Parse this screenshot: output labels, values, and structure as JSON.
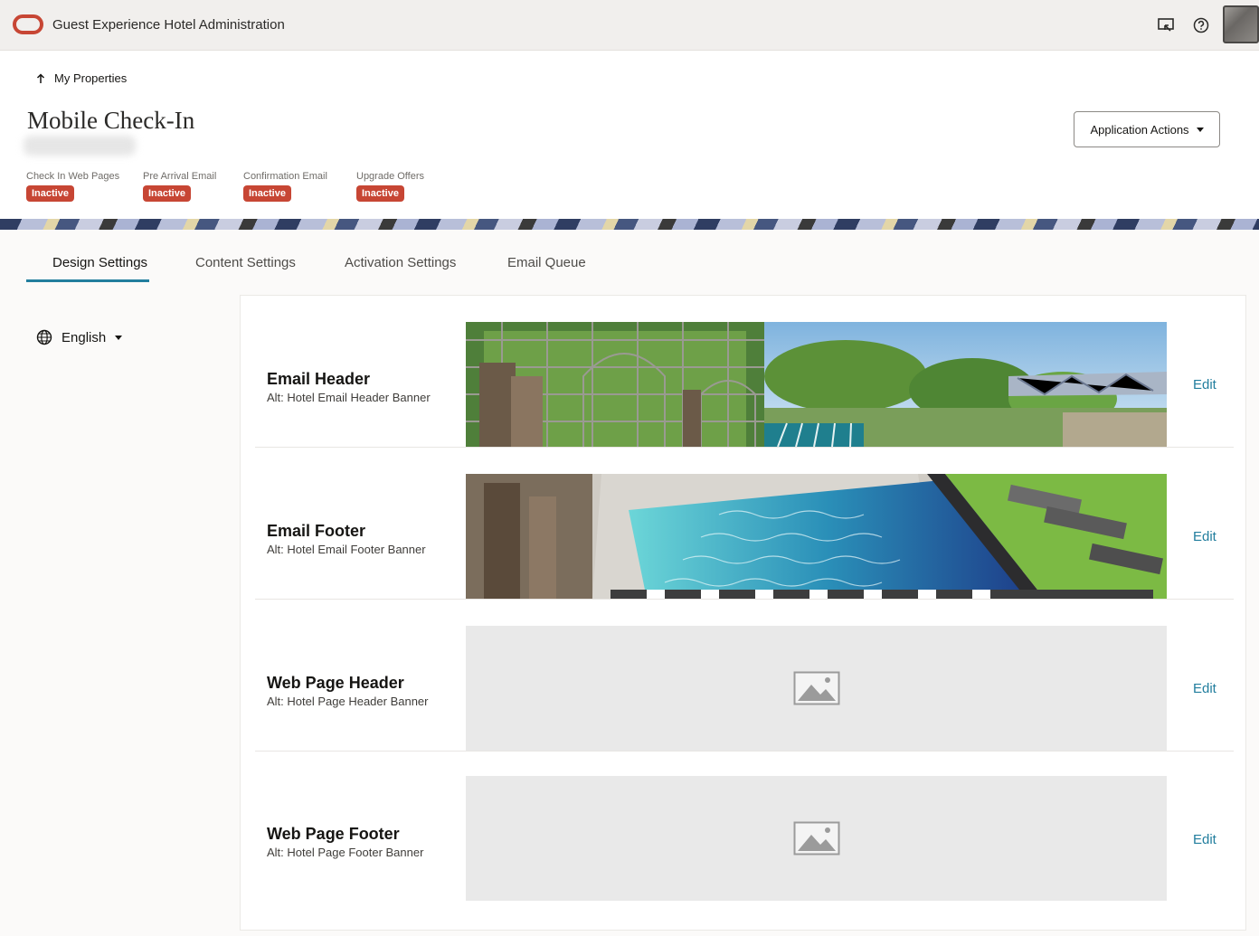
{
  "topbar": {
    "app_title": "Guest Experience Hotel Administration",
    "icons": [
      "cast-icon",
      "help-icon",
      "avatar"
    ]
  },
  "header": {
    "back_label": "My Properties",
    "title": "Mobile Check-In",
    "statuses": [
      {
        "label": "Check In Web Pages",
        "badge": "Inactive"
      },
      {
        "label": "Pre Arrival Email",
        "badge": "Inactive"
      },
      {
        "label": "Confirmation Email",
        "badge": "Inactive"
      },
      {
        "label": "Upgrade Offers",
        "badge": "Inactive"
      }
    ],
    "app_actions_label": "Application Actions"
  },
  "tabs": [
    {
      "label": "Design Settings",
      "active": true
    },
    {
      "label": "Content Settings",
      "active": false
    },
    {
      "label": "Activation Settings",
      "active": false
    },
    {
      "label": "Email Queue",
      "active": false
    }
  ],
  "language": {
    "selected": "English"
  },
  "rows": [
    {
      "title": "Email Header",
      "alt": "Alt: Hotel Email Header Banner",
      "edit": "Edit",
      "image": "garden-pool-photo"
    },
    {
      "title": "Email Footer",
      "alt": "Alt: Hotel Email Footer Banner",
      "edit": "Edit",
      "image": "pool-photo"
    },
    {
      "title": "Web Page Header",
      "alt": "Alt: Hotel Page Header Banner",
      "edit": "Edit",
      "image": "image-placeholder-icon"
    },
    {
      "title": "Web Page Footer",
      "alt": "Alt: Hotel Page Footer Banner",
      "edit": "Edit",
      "image": "image-placeholder-icon"
    }
  ],
  "colors": {
    "accent": "#227e9e",
    "badge": "#c74634",
    "brand": "#c74634"
  }
}
